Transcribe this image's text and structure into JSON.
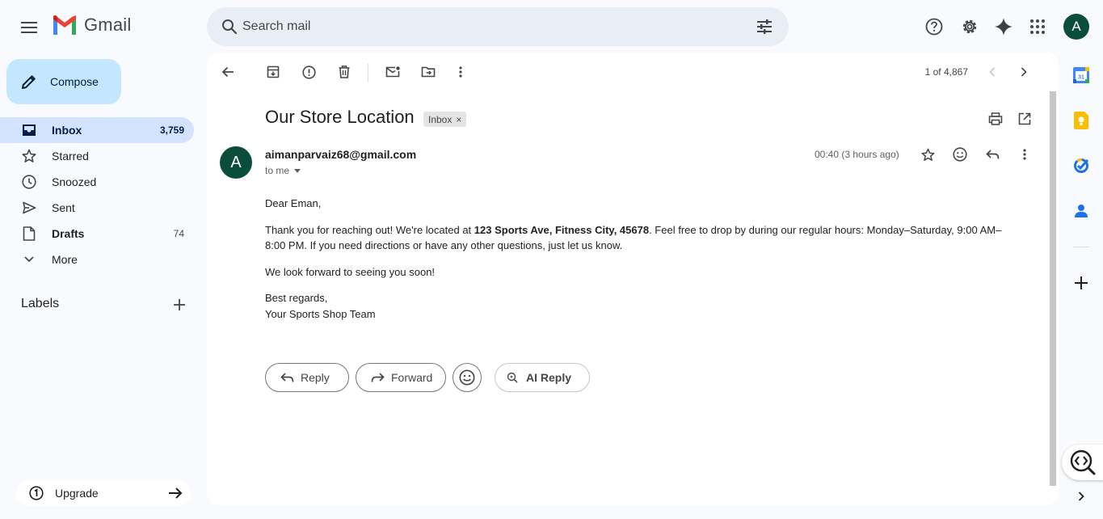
{
  "app": {
    "name": "Gmail"
  },
  "search": {
    "placeholder": "Search mail"
  },
  "account": {
    "avatar_letter": "A"
  },
  "sidebar": {
    "compose_label": "Compose",
    "items": [
      {
        "label": "Inbox",
        "count": "3,759",
        "icon": "inbox-icon"
      },
      {
        "label": "Starred",
        "count": "",
        "icon": "star-icon"
      },
      {
        "label": "Snoozed",
        "count": "",
        "icon": "clock-icon"
      },
      {
        "label": "Sent",
        "count": "",
        "icon": "send-icon"
      },
      {
        "label": "Drafts",
        "count": "74",
        "icon": "draft-icon"
      },
      {
        "label": "More",
        "count": "",
        "icon": "chevron-down-icon"
      }
    ],
    "labels_heading": "Labels",
    "upgrade_label": "Upgrade"
  },
  "toolbar": {
    "pager": "1 of 4,867"
  },
  "email": {
    "subject": "Our Store Location",
    "label_chip": "Inbox",
    "chip_close": "×",
    "sender_initial": "A",
    "sender": "aimanparvaiz68@gmail.com",
    "recipient": "to me",
    "timestamp": "00:40 (3 hours ago)",
    "body": {
      "greeting": "Dear Eman,",
      "para1_before": "Thank you for reaching out! We're located at ",
      "para1_bold": "123 Sports Ave, Fitness City, 45678",
      "para1_after": ". Feel free to drop by during our regular hours: Monday–Saturday, 9:00 AM–8:00 PM. If you need directions or have any other questions, just let us know.",
      "para2": "We look forward to seeing you soon!",
      "closing": "Best regards,",
      "signature": "Your Sports Shop Team"
    }
  },
  "actions": {
    "reply": "Reply",
    "forward": "Forward",
    "ai_reply": "AI Reply"
  },
  "colors": {
    "accent": "#c2e7ff",
    "active_nav": "#d3e3fd",
    "avatar": "#0b4d3b"
  }
}
